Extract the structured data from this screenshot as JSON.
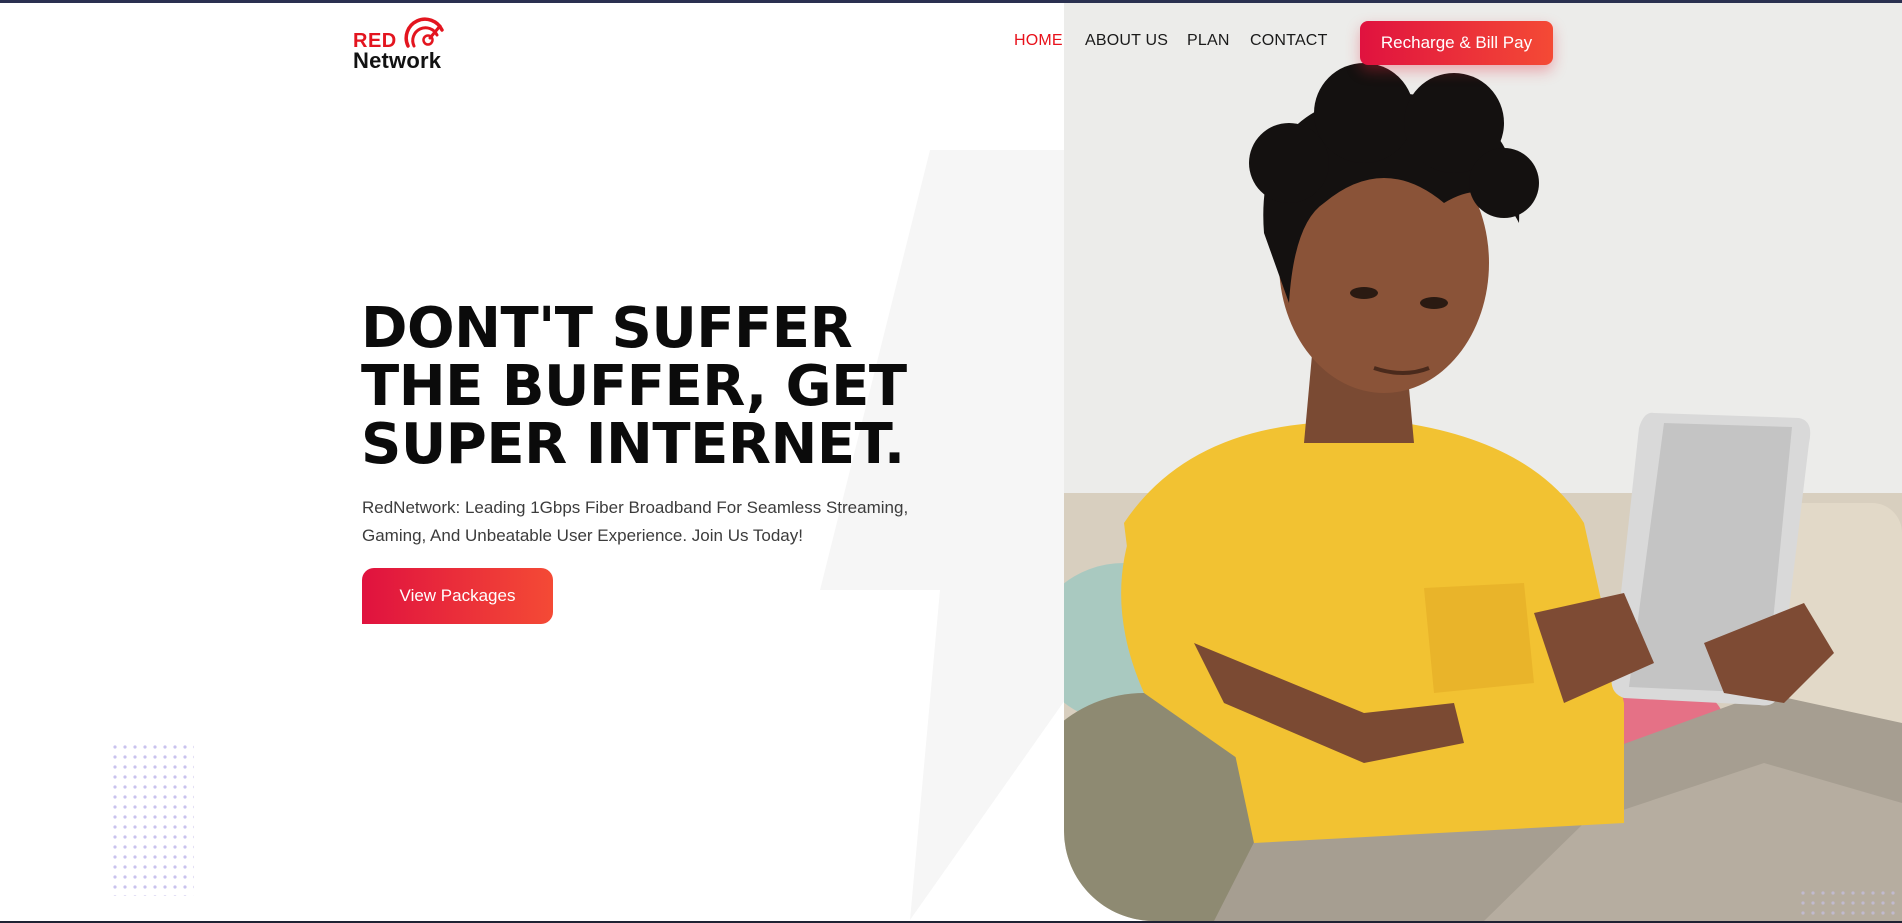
{
  "brand": {
    "logo_top": "RED",
    "logo_bottom": "Network",
    "logo_icon": "signal-speedometer-icon",
    "primary_color": "#e3151f",
    "gradient_start": "#e0123f",
    "gradient_end": "#f44a35"
  },
  "nav": {
    "items": [
      {
        "label": "HOME",
        "active": true
      },
      {
        "label": "ABOUT US",
        "active": false
      },
      {
        "label": "PLAN",
        "active": false
      },
      {
        "label": "CONTACT",
        "active": false
      }
    ],
    "cta_label": "Recharge & Bill Pay"
  },
  "hero": {
    "title": "DONT'T SUFFER THE BUFFER, GET SUPER INTERNET.",
    "subtitle": "RedNetwork: Leading 1Gbps Fiber Broadband For Seamless Streaming, Gaming, And Unbeatable User Experience. Join Us Today!",
    "cta_label": "View Packages",
    "image_icon": "person-using-tablet-photo"
  }
}
